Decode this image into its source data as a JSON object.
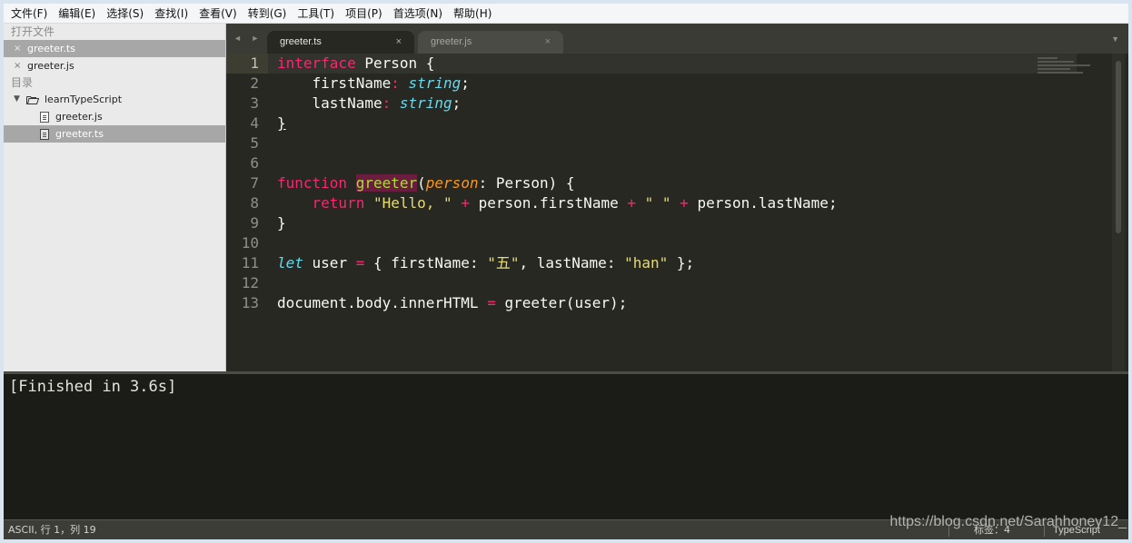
{
  "menubar": {
    "items": [
      "文件(F)",
      "编辑(E)",
      "选择(S)",
      "查找(I)",
      "查看(V)",
      "转到(G)",
      "工具(T)",
      "项目(P)",
      "首选项(N)",
      "帮助(H)"
    ]
  },
  "sidebar": {
    "open_files_header": "打开文件",
    "open_files": [
      "greeter.ts",
      "greeter.js"
    ],
    "folders_header": "目录",
    "folder_name": "learnTypeScript",
    "folder_files": [
      "greeter.js",
      "greeter.ts"
    ],
    "close_glyph": "×",
    "expand_glyph": "▼"
  },
  "tabs": {
    "nav": "◄ ►",
    "active": {
      "label": "greeter.ts",
      "close": "×"
    },
    "inactive": {
      "label": "greeter.js",
      "close": "×"
    },
    "dropdown": "▼"
  },
  "editor": {
    "line_numbers": [
      "1",
      "2",
      "3",
      "4",
      "5",
      "6",
      "7",
      "8",
      "9",
      "10",
      "11",
      "12",
      "13"
    ],
    "current_line": 1,
    "code": {
      "l1_kw": "interface",
      "l1_name": " Person ",
      "l1_brace": "{",
      "l2_indent": "    ",
      "l2_prop": "firstName",
      "l2_colon": ": ",
      "l2_type": "string",
      "l2_end": ";",
      "l3_indent": "    ",
      "l3_prop": "lastName",
      "l3_colon": ": ",
      "l3_type": "string",
      "l3_end": ";",
      "l4_brace": "}",
      "l7_kw": "function",
      "l7_fn": "greeter",
      "l7_open": "(",
      "l7_param": "person",
      "l7_rest": ": Person) {",
      "l8_indent": "    ",
      "l8_kw": "return",
      "l8_s1": "\"Hello, \"",
      "l8_plus1": "+",
      "l8_mid1": " person.firstName ",
      "l8_plus2": "+",
      "l8_s2": "\" \"",
      "l8_plus3": "+",
      "l8_mid2": " person.lastName;",
      "l9_brace": "}",
      "l11_kw": "let",
      "l11_a": " user ",
      "l11_eq": "=",
      "l11_b": " { firstName: ",
      "l11_s1": "\"五\"",
      "l11_c": ", lastName: ",
      "l11_s2": "\"han\"",
      "l11_d": " };",
      "l13_a": "document.body.innerHTML ",
      "l13_eq": "=",
      "l13_b": " greeter(user);"
    }
  },
  "output": {
    "text": "[Finished in 3.6s]"
  },
  "statusbar": {
    "left": "ASCII, 行 1，列 19",
    "tab_size": "标签：4",
    "syntax": "TypeScript"
  },
  "watermark": "https://blog.csdn.net/Sarahhoney12_",
  "colors": {
    "editor_bg": "#272822",
    "keyword": "#f92672",
    "type": "#66d9ef",
    "function": "#a6e22e",
    "string": "#e6db74",
    "parameter": "#fd971f"
  }
}
